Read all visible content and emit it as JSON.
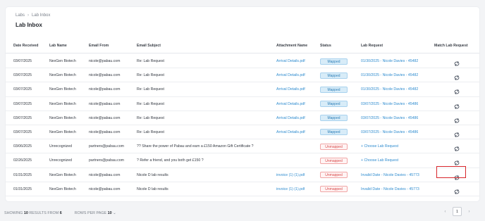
{
  "breadcrumb": {
    "root": "Labs",
    "separator": "›",
    "current": "Lab Inbox"
  },
  "page_title": "Lab Inbox",
  "columns": [
    "Date Received",
    "Lab Name",
    "Email From",
    "Email Subject",
    "Attachment Name",
    "Status",
    "Lab Request",
    "Match Lab Request"
  ],
  "rows": [
    {
      "date": "03/07/2025",
      "lab": "NexGen Biotech",
      "from": "nicole@pabau.com",
      "subject": "Re: Lab Request",
      "attachment": "Arrival Details.pdf",
      "status": "Mapped",
      "request": "01/30/2025 - Nicole Davies - 45482"
    },
    {
      "date": "03/07/2025",
      "lab": "NexGen Biotech",
      "from": "nicole@pabau.com",
      "subject": "Re: Lab Request",
      "attachment": "Arrival Details.pdf",
      "status": "Mapped",
      "request": "01/30/2025 - Nicole Davies - 45482"
    },
    {
      "date": "03/07/2025",
      "lab": "NexGen Biotech",
      "from": "nicole@pabau.com",
      "subject": "Re: Lab Request",
      "attachment": "Arrival Details.pdf",
      "status": "Mapped",
      "request": "01/30/2025 - Nicole Davies - 45482"
    },
    {
      "date": "03/07/2025",
      "lab": "NexGen Biotech",
      "from": "nicole@pabau.com",
      "subject": "Re: Lab Request",
      "attachment": "Arrival Details.pdf",
      "status": "Mapped",
      "request": "03/07/2025 - Nicole Davies - 45486"
    },
    {
      "date": "03/07/2025",
      "lab": "NexGen Biotech",
      "from": "nicole@pabau.com",
      "subject": "Re: Lab Request",
      "attachment": "Arrival Details.pdf",
      "status": "Mapped",
      "request": "03/07/2025 - Nicole Davies - 45486"
    },
    {
      "date": "03/07/2025",
      "lab": "NexGen Biotech",
      "from": "nicole@pabau.com",
      "subject": "Re: Lab Request",
      "attachment": "Arrival Details.pdf",
      "status": "Mapped",
      "request": "03/07/2025 - Nicole Davies - 45486"
    },
    {
      "date": "03/06/2025",
      "lab": "Unrecognized",
      "from": "partners@pabau.com",
      "subject": "?? Share the power of Pabau and earn a £150 Amazon Gift Certificate ?",
      "attachment": "",
      "status": "Unmapped",
      "request": "+ Choose Lab Request"
    },
    {
      "date": "02/26/2025",
      "lab": "Unrecognized",
      "from": "partners@pabau.com",
      "subject": "? Refer a friend, and you both get £150 ?",
      "attachment": "",
      "status": "Unmapped",
      "request": "+ Choose Lab Request"
    },
    {
      "date": "01/31/2025",
      "lab": "NexGen Biotech",
      "from": "nicole@pabau.com",
      "subject": "Nicole D lab results",
      "attachment": "invoice (1) (1).pdf",
      "status": "Unmapped",
      "request": "Invalid Date - Nicole Davies - 45773"
    },
    {
      "date": "01/31/2025",
      "lab": "NexGen Biotech",
      "from": "nicole@pabau.com",
      "subject": "Nicole D lab results",
      "attachment": "invoice (1) (1).pdf",
      "status": "Unmapped",
      "request": "Invalid Date - Nicole Davies - 45773"
    }
  ],
  "footer": {
    "showing_prefix": "SHOWING",
    "showing_count": "10",
    "results_from_label": "RESULTS FROM",
    "results_total": "6",
    "rows_per_page_label": "ROWS PER PAGE",
    "rows_per_page_value": "10",
    "rows_per_page_caret": "⌄",
    "current_page": "1",
    "prev_icon": "‹",
    "next_icon": "›"
  },
  "colors": {
    "link": "#2f8ccf",
    "mapped": "#d8ecf8",
    "unmapped_border": "#f0a5a5",
    "highlight": "#d8262b"
  }
}
